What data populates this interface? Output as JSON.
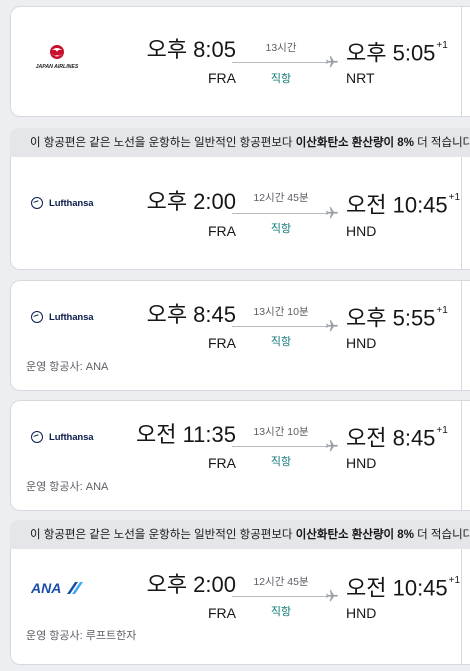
{
  "colors": {
    "direct": "#0d7a76",
    "jal_red": "#c8102e",
    "lufthansa_navy": "#0b1e4a",
    "ana_blue": "#1a4ea8"
  },
  "banner_text": {
    "prefix": "이 항공편은 같은 노선을 운항하는 일반적인 항공편보다 ",
    "highlight": "이산화탄소 환산량이 8%",
    "suffix": " 더 적습니다"
  },
  "flights": [
    {
      "airline_logo": "jal-logo",
      "airline_logo_text": "JAPAN AIRLINES",
      "dep_time": "오후 8:05",
      "dep_code": "FRA",
      "duration": "13시간",
      "stops": "직항",
      "arr_time": "오후 5:05",
      "arr_day_offset": "+1",
      "arr_code": "NRT",
      "operator": ""
    },
    {
      "airline_logo": "lufthansa-logo",
      "airline_logo_text": "Lufthansa",
      "dep_time": "오후 2:00",
      "dep_code": "FRA",
      "duration": "12시간 45분",
      "stops": "직항",
      "arr_time": "오전 10:45",
      "arr_day_offset": "+1",
      "arr_code": "HND",
      "operator": ""
    },
    {
      "airline_logo": "lufthansa-logo",
      "airline_logo_text": "Lufthansa",
      "dep_time": "오후 8:45",
      "dep_code": "FRA",
      "duration": "13시간 10분",
      "stops": "직항",
      "arr_time": "오후 5:55",
      "arr_day_offset": "+1",
      "arr_code": "HND",
      "operator": "운영 항공사: ANA"
    },
    {
      "airline_logo": "lufthansa-logo",
      "airline_logo_text": "Lufthansa",
      "dep_time": "오전 11:35",
      "dep_code": "FRA",
      "duration": "13시간 10분",
      "stops": "직항",
      "arr_time": "오전 8:45",
      "arr_day_offset": "+1",
      "arr_code": "HND",
      "operator": "운영 항공사: ANA"
    },
    {
      "airline_logo": "ana-logo",
      "airline_logo_text": "ANA",
      "dep_time": "오후 2:00",
      "dep_code": "FRA",
      "duration": "12시간 45분",
      "stops": "직항",
      "arr_time": "오전 10:45",
      "arr_day_offset": "+1",
      "arr_code": "HND",
      "operator": "운영 항공사: 루프트한자"
    }
  ]
}
